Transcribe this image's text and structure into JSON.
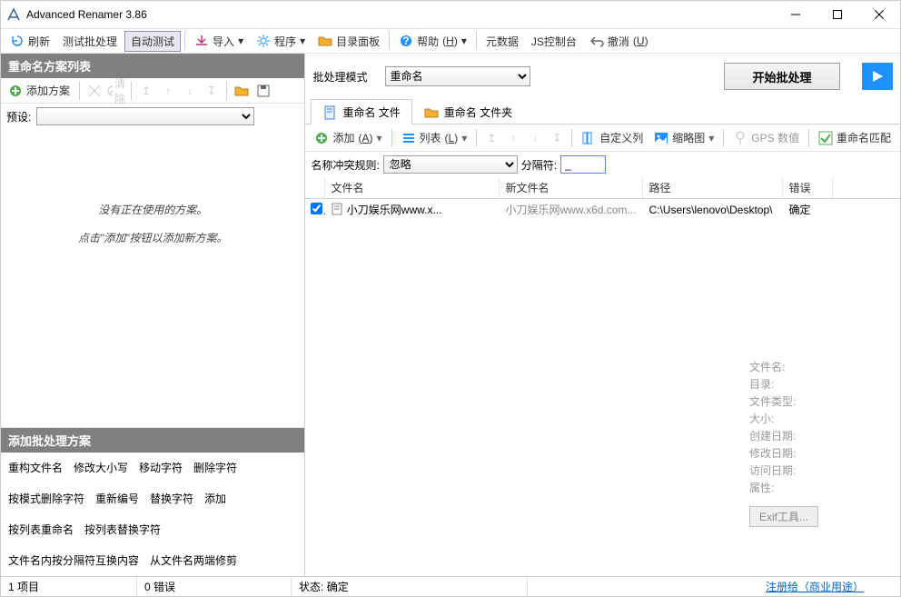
{
  "window": {
    "title": "Advanced Renamer 3.86"
  },
  "toolbar": {
    "refresh": "刷新",
    "test_batch": "测试批处理",
    "auto_test": "自动测试",
    "import": "导入",
    "program": "程序",
    "dir_panel": "目录面板",
    "help": "帮助",
    "help_key": "H",
    "metadata": "元数据",
    "js_console": "JS控制台",
    "undo": "撤消",
    "undo_key": "U"
  },
  "left": {
    "header": "重命名方案列表",
    "add_method": "添加方案",
    "clear": "清除",
    "preset_label": "预设:",
    "hint1": "没有正在使用的方案。",
    "hint2": "点击\"添加\"按钮以添加新方案。",
    "methods_header": "添加批处理方案",
    "methods": [
      "重构文件名",
      "修改大小写",
      "移动字符",
      "删除字符",
      "按模式删除字符",
      "重新编号",
      "替换字符",
      "添加",
      "按列表重命名",
      "按列表替换字符",
      "文件名内按分隔符互换内容",
      "从文件名两端修剪"
    ]
  },
  "right": {
    "batch_mode_label": "批处理模式",
    "batch_mode_value": "重命名",
    "start_label": "开始批处理",
    "tab_files": "重命名 文件",
    "tab_folders": "重命名 文件夹",
    "add": "添加",
    "add_key": "A",
    "list": "列表",
    "list_key": "L",
    "custom_cols": "自定义列",
    "thumbs": "缩略图",
    "gps": "GPS 数值",
    "rename_match": "重命名匹配",
    "conflict_label": "名称冲突规则:",
    "conflict_value": "忽略",
    "sep_label": "分隔符:",
    "sep_value": "_",
    "columns": {
      "name": "文件名",
      "newname": "新文件名",
      "path": "路径",
      "error": "错误"
    },
    "rows": [
      {
        "name": "小刀娱乐网www.x...",
        "newname": "小刀娱乐网www.x6d.com...",
        "path": "C:\\Users\\lenovo\\Desktop\\",
        "error": "确定"
      }
    ],
    "info": {
      "filename": "文件名:",
      "dir": "目录:",
      "filetype": "文件类型:",
      "size": "大小:",
      "created": "创建日期:",
      "modified": "修改日期:",
      "accessed": "访问日期:",
      "attrs": "属性:",
      "exif_btn": "Exif工具..."
    }
  },
  "status": {
    "items": "1 项目",
    "errors": "0 错误",
    "state_label": "状态:",
    "state_value": "确定",
    "register": "注册给（商业用途）"
  }
}
